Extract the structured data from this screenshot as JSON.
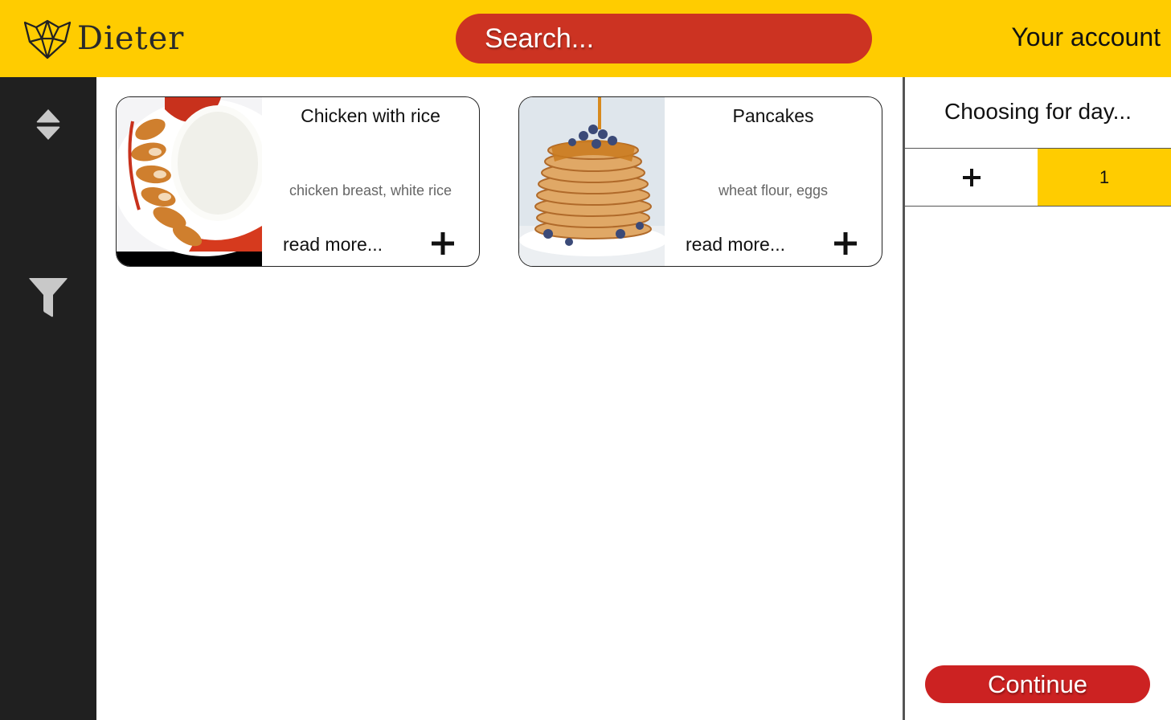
{
  "header": {
    "app_name": "Dieter",
    "search_placeholder": "Search...",
    "account_label": "Your account"
  },
  "sidebar": {
    "items": [
      {
        "icon": "sort-icon"
      },
      {
        "icon": "filter-icon"
      }
    ]
  },
  "recipes": [
    {
      "title": "Chicken with rice",
      "ingredients": "chicken breast, white rice",
      "read_more": "read more...",
      "add_icon": "plus-icon"
    },
    {
      "title": "Pancakes",
      "ingredients": "wheat flour, eggs",
      "read_more": "read more...",
      "add_icon": "plus-icon"
    }
  ],
  "panel": {
    "title": "Choosing for day...",
    "add_day_icon": "plus-icon",
    "days": [
      "1"
    ],
    "continue_label": "Continue"
  },
  "colors": {
    "brand_yellow": "#ffcc00",
    "brand_red": "#cc3322",
    "sidebar_bg": "#202020"
  }
}
